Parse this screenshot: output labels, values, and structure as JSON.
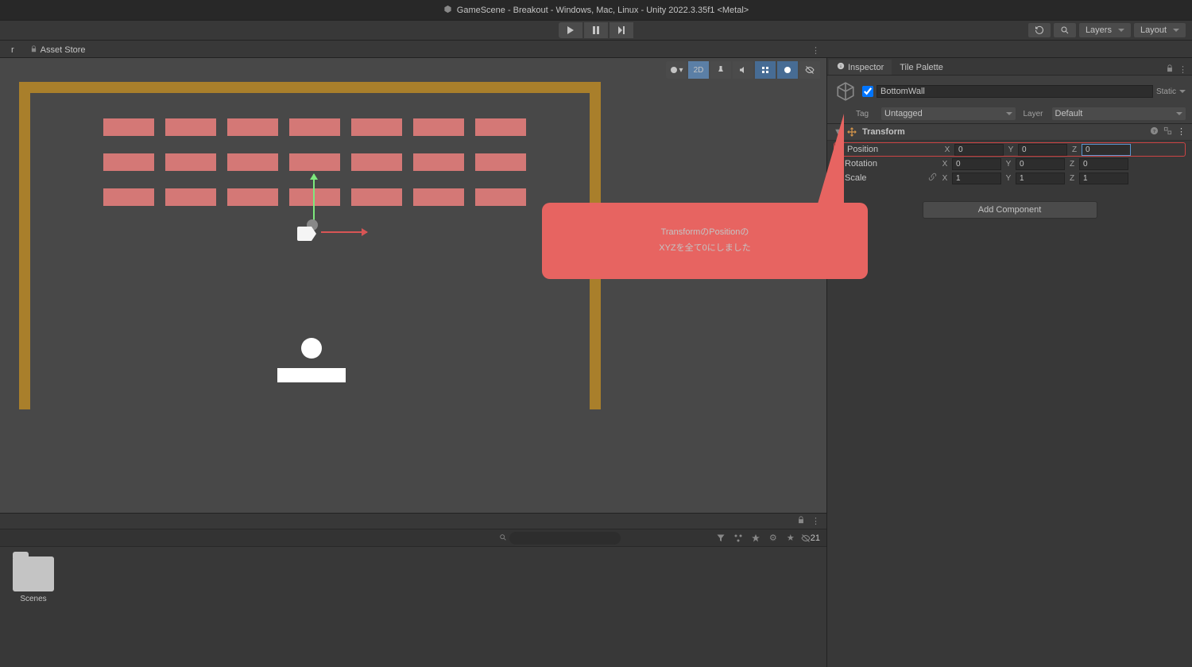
{
  "titlebar": "GameScene - Breakout - Windows, Mac, Linux - Unity 2022.3.35f1 <Metal>",
  "tabs": {
    "asset_store": "Asset Store"
  },
  "toolbar": {
    "layers": "Layers",
    "layout": "Layout"
  },
  "scene_toolbar": {
    "mode_2d": "2D",
    "hidden_count": "21"
  },
  "inspector": {
    "tab_inspector": "Inspector",
    "tab_tilepalette": "Tile Palette",
    "object_name": "BottomWall",
    "static_label": "Static",
    "tag_label": "Tag",
    "tag_value": "Untagged",
    "layer_label": "Layer",
    "layer_value": "Default",
    "transform": {
      "title": "Transform",
      "position_label": "Position",
      "rotation_label": "Rotation",
      "scale_label": "Scale",
      "position": {
        "x": "0",
        "y": "0",
        "z": "0"
      },
      "rotation": {
        "x": "0",
        "y": "0",
        "z": "0"
      },
      "scale": {
        "x": "1",
        "y": "1",
        "z": "1"
      }
    },
    "add_component": "Add Component"
  },
  "folders": {
    "scenes": "Scenes"
  },
  "callout": {
    "line1": "TransformのPositionの",
    "line2": "XYZを全て0にしました"
  },
  "axis": {
    "x": "X",
    "y": "Y",
    "z": "Z"
  }
}
